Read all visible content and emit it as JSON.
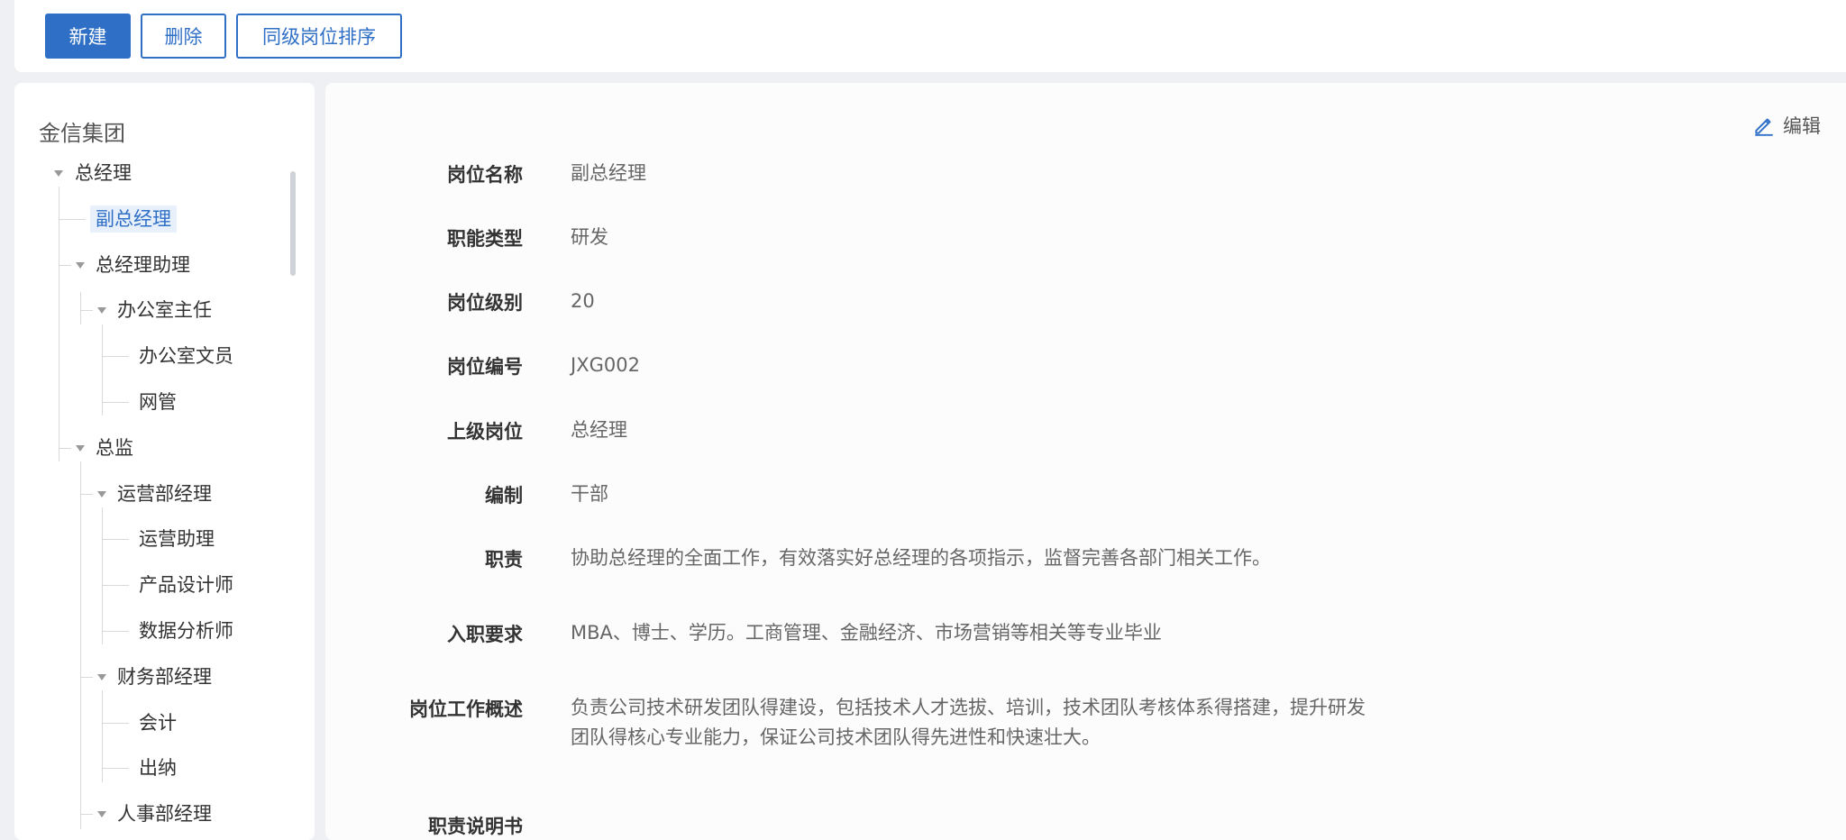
{
  "toolbar": {
    "new_label": "新建",
    "delete_label": "删除",
    "sort_label": "同级岗位排序"
  },
  "sidebar": {
    "org_name": "金信集团",
    "tree": [
      {
        "label": "总经理",
        "level": 0,
        "expanded": true
      },
      {
        "label": "副总经理",
        "level": 1,
        "selected": true
      },
      {
        "label": "总经理助理",
        "level": 1,
        "expanded": true
      },
      {
        "label": "办公室主任",
        "level": 2,
        "expanded": true
      },
      {
        "label": "办公室文员",
        "level": 3
      },
      {
        "label": "网管",
        "level": 3
      },
      {
        "label": "总监",
        "level": 1,
        "expanded": true
      },
      {
        "label": "运营部经理",
        "level": 2,
        "expanded": true
      },
      {
        "label": "运营助理",
        "level": 3
      },
      {
        "label": "产品设计师",
        "level": 3
      },
      {
        "label": "数据分析师",
        "level": 3
      },
      {
        "label": "财务部经理",
        "level": 2,
        "expanded": true
      },
      {
        "label": "会计",
        "level": 3
      },
      {
        "label": "出纳",
        "level": 3
      },
      {
        "label": "人事部经理",
        "level": 2,
        "expanded": true
      }
    ]
  },
  "detail": {
    "edit_label": "编辑",
    "fields": [
      {
        "label": "岗位名称",
        "value": "副总经理"
      },
      {
        "label": "职能类型",
        "value": "研发"
      },
      {
        "label": "岗位级别",
        "value": "20"
      },
      {
        "label": "岗位编号",
        "value": "JXG002"
      },
      {
        "label": "上级岗位",
        "value": "总经理"
      },
      {
        "label": "编制",
        "value": "干部"
      },
      {
        "label": "职责",
        "value": "协助总经理的全面工作，有效落实好总经理的各项指示，监督完善各部门相关工作。"
      },
      {
        "label": "入职要求",
        "value": "MBA、博士、学历。工商管理、金融经济、市场营销等相关等专业毕业"
      },
      {
        "label": "岗位工作概述",
        "value": "负责公司技术研发团队得建设，包括技术人才选拔、培训，技术团队考核体系得搭建，提升研发\n团队得核心专业能力，保证公司技术团队得先进性和快速壮大。"
      },
      {
        "label": "职责说明书",
        "value": ""
      }
    ]
  }
}
